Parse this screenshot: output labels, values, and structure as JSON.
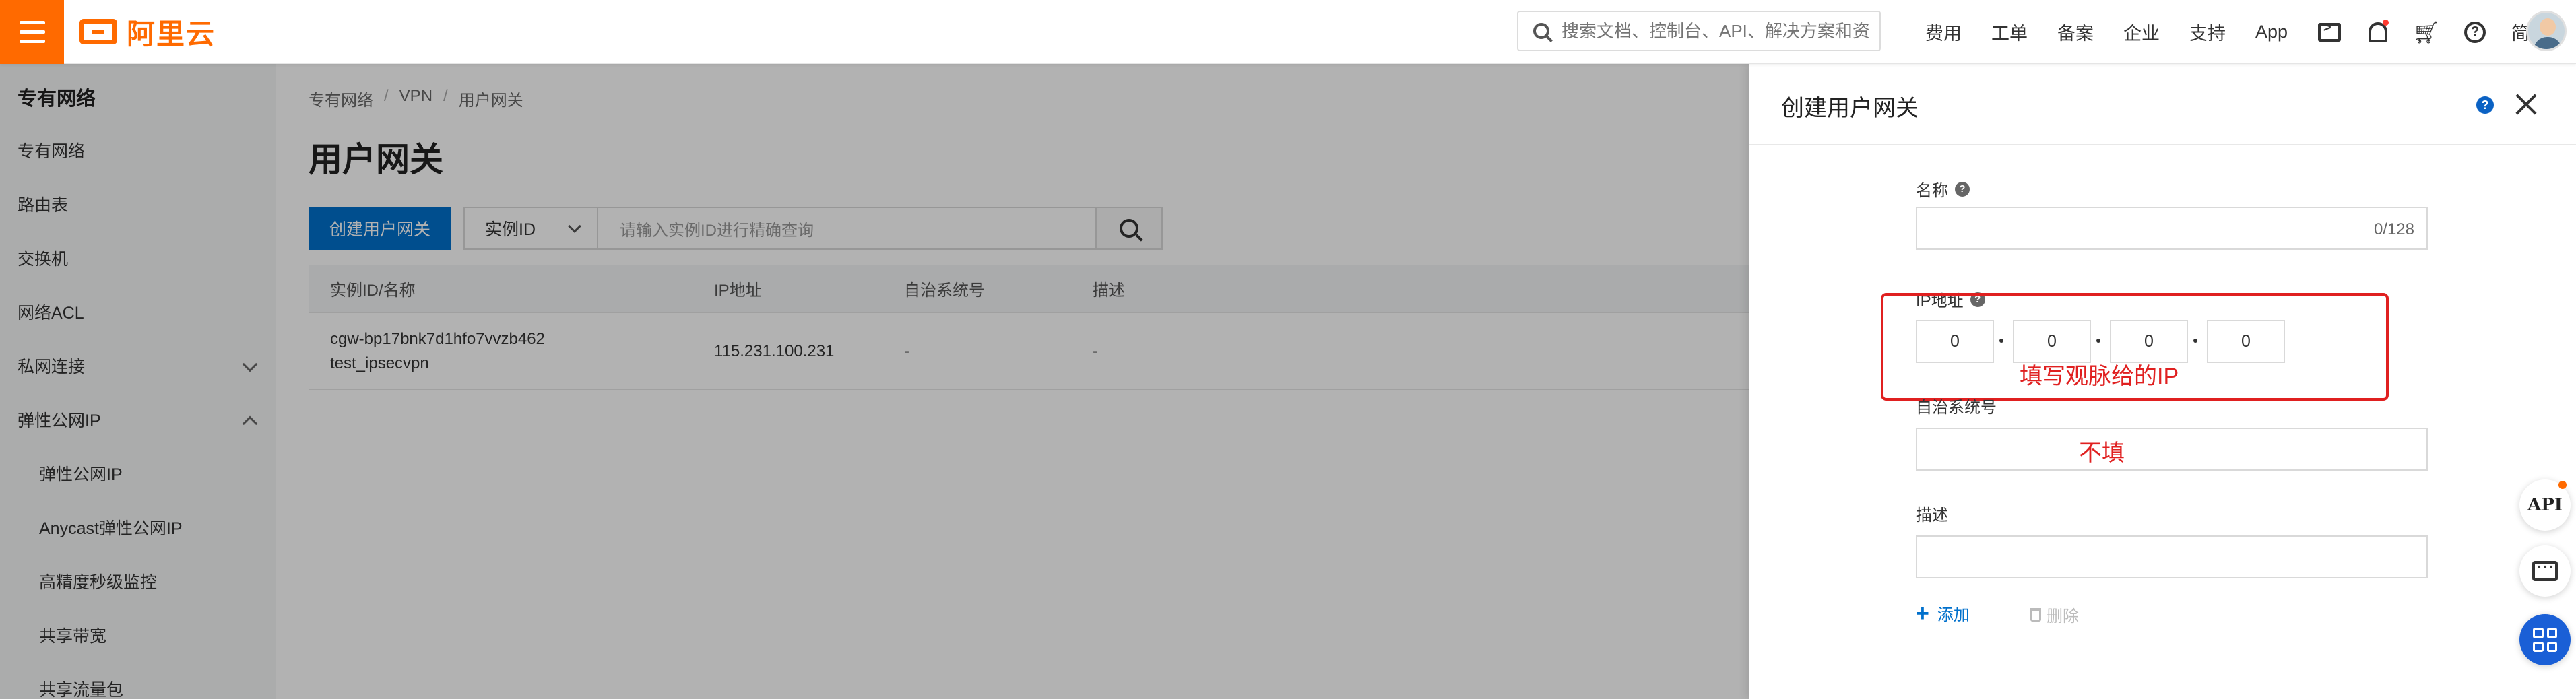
{
  "header": {
    "logo_text": "阿里云",
    "search_placeholder": "搜索文档、控制台、API、解决方案和资源",
    "nav": [
      "费用",
      "工单",
      "备案",
      "企业",
      "支持",
      "App"
    ],
    "lang": "简体"
  },
  "sidebar": {
    "title": "专有网络",
    "items": [
      {
        "label": "专有网络"
      },
      {
        "label": "路由表"
      },
      {
        "label": "交换机"
      },
      {
        "label": "网络ACL"
      },
      {
        "label": "私网连接"
      },
      {
        "label": "弹性公网IP"
      },
      {
        "label": "弹性公网IP"
      },
      {
        "label": "Anycast弹性公网IP"
      },
      {
        "label": "高精度秒级监控"
      },
      {
        "label": "共享带宽"
      },
      {
        "label": "共享流量包"
      }
    ]
  },
  "main": {
    "breadcrumb": [
      "专有网络",
      "VPN",
      "用户网关"
    ],
    "title": "用户网关",
    "create_button": "创建用户网关",
    "filter_select": "实例ID",
    "filter_placeholder": "请输入实例ID进行精确查询",
    "table": {
      "headers": [
        "实例ID/名称",
        "IP地址",
        "自治系统号",
        "描述"
      ],
      "rows": [
        {
          "id": "cgw-bp17bnk7d1hfo7vvzb462",
          "name": "test_ipsecvpn",
          "ip": "115.231.100.231",
          "asn": "-",
          "desc": "-"
        }
      ]
    }
  },
  "drawer": {
    "title": "创建用户网关",
    "name_label": "名称",
    "name_count": "0/128",
    "ip_label": "IP地址",
    "ip_parts": [
      "0",
      "0",
      "0",
      "0"
    ],
    "asn_label": "自治系统号",
    "desc_label": "描述",
    "add_label": "添加",
    "delete_label": "删除",
    "note_ip": "填写观脉给的IP",
    "note_asn": "不填"
  },
  "floating": {
    "api_label": "API"
  },
  "colors": {
    "brand": "#ff6a00",
    "primary": "#0070cc",
    "annotation": "#e02020"
  }
}
